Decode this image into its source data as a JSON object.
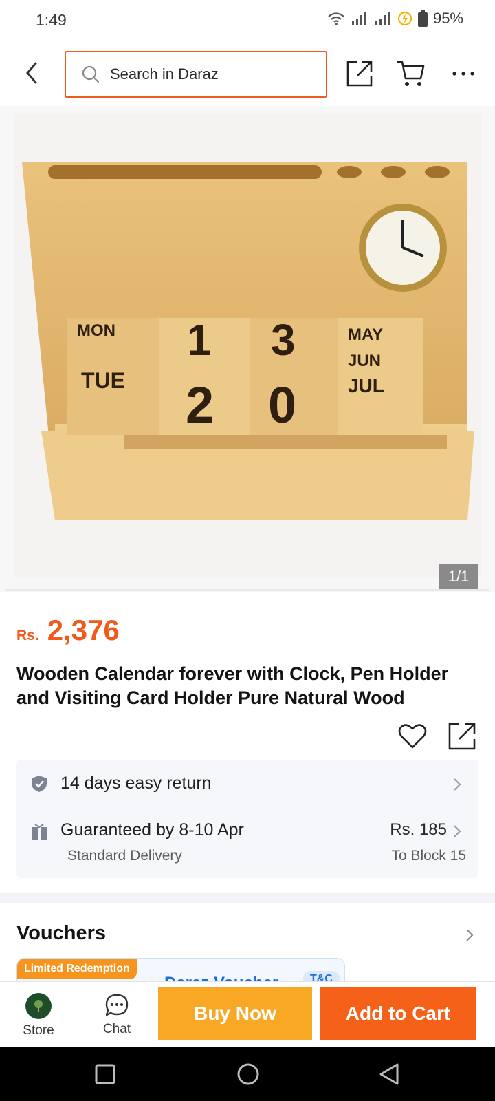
{
  "status_bar": {
    "time": "1:49",
    "battery": "95%"
  },
  "header": {
    "search_placeholder": "Search in Daraz"
  },
  "gallery": {
    "counter": "1/1"
  },
  "product": {
    "currency": "Rs.",
    "price": "2,376",
    "title": "Wooden Calendar forever with Clock, Pen Holder and Visiting Card Holder Pure Natural Wood"
  },
  "service": {
    "return_text": "14 days easy return",
    "delivery_text": "Guaranteed by 8-10 Apr",
    "delivery_type": "Standard Delivery",
    "delivery_price": "Rs. 185",
    "delivery_location": "To Block 15"
  },
  "vouchers": {
    "title": "Vouchers",
    "badge": "Limited Redemption",
    "voucher_name": "Daraz Voucher",
    "tc": "T&C"
  },
  "bottom_bar": {
    "store_label": "Store",
    "chat_label": "Chat",
    "buy_now": "Buy Now",
    "add_to_cart": "Add to Cart"
  },
  "colors": {
    "accent": "#f05a1a",
    "buy_now": "#f9a826",
    "add_to_cart": "#f6611a"
  }
}
